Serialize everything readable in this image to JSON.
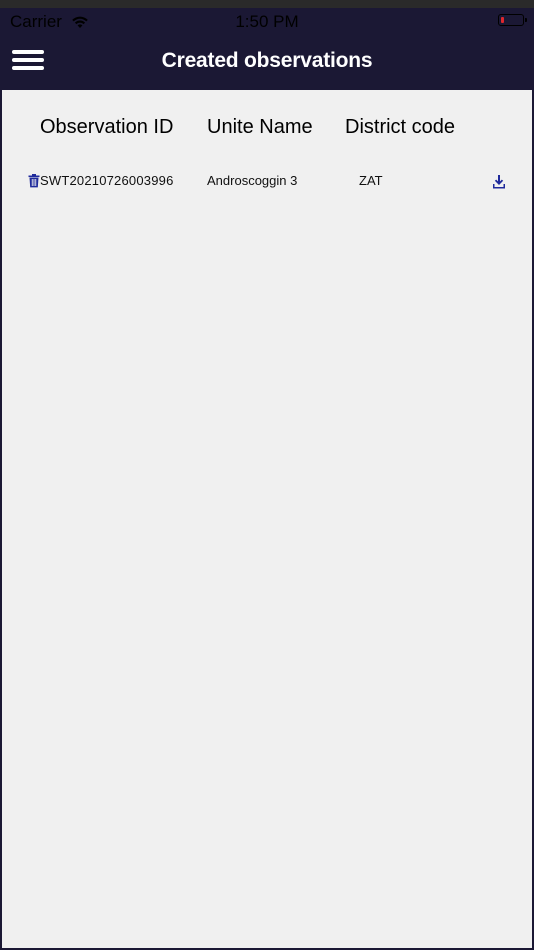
{
  "status_bar": {
    "carrier": "Carrier",
    "time": "1:50 PM",
    "battery_color": "#e0272d"
  },
  "nav": {
    "title": "Created observations",
    "menu_icon": "hamburger-menu-icon",
    "bar_color": "#1b1834"
  },
  "table": {
    "columns": [
      "Observation ID",
      "Unite Name",
      "District code"
    ],
    "rows": [
      {
        "observation_id": "SWT20210726003996",
        "unite_name": "Androscoggin 3",
        "district_code": "ZAT",
        "delete_icon": "trash-icon",
        "download_icon": "download-icon"
      }
    ]
  },
  "colors": {
    "accent": "#1f2a9b",
    "content_bg": "#f0f0f0"
  }
}
